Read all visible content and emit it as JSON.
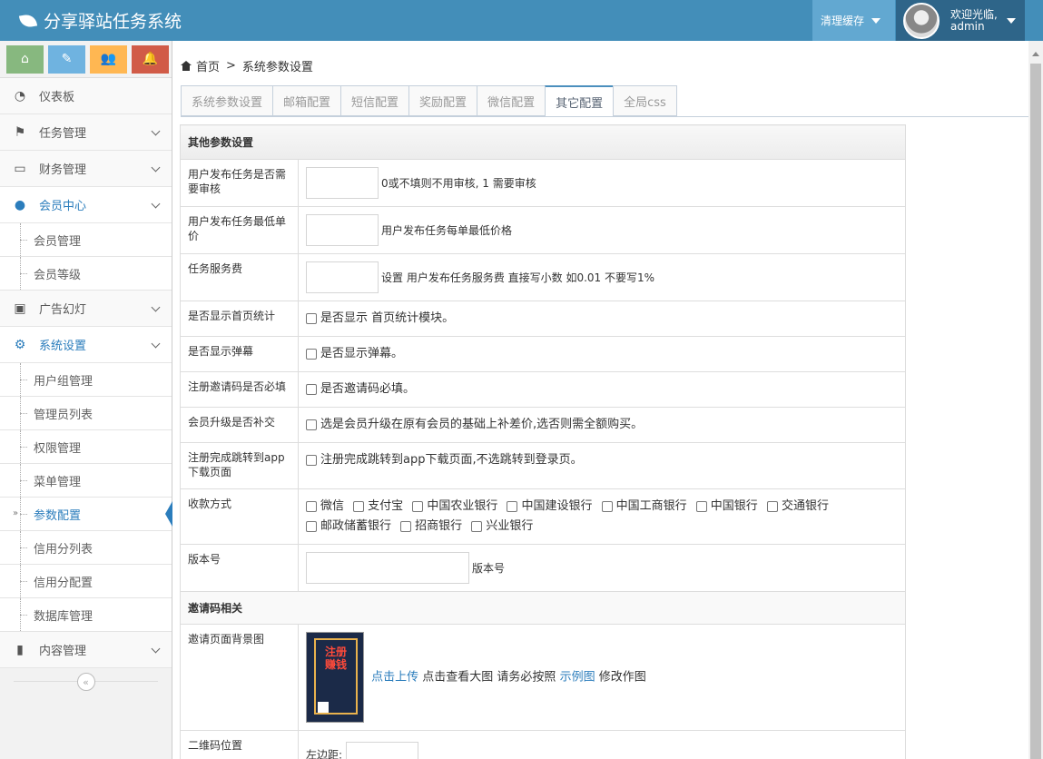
{
  "app": {
    "title": "分享驿站任务系统"
  },
  "topbar": {
    "clear_cache": "清理缓存",
    "welcome": "欢迎光临,",
    "username": "admin"
  },
  "sidebar": {
    "shortcuts": [
      "home-icon",
      "pencil-icon",
      "users-icon",
      "bell-icon"
    ],
    "items": [
      {
        "label": "仪表板",
        "icon": "dashboard-icon"
      },
      {
        "label": "任务管理",
        "icon": "flag-icon"
      },
      {
        "label": "财务管理",
        "icon": "inbox-icon"
      },
      {
        "label": "会员中心",
        "icon": "user-icon",
        "children": [
          "会员管理",
          "会员等级"
        ]
      },
      {
        "label": "广告幻灯",
        "icon": "picture-icon"
      },
      {
        "label": "系统设置",
        "icon": "cog-icon",
        "children": [
          "用户组管理",
          "管理员列表",
          "权限管理",
          "菜单管理",
          "参数配置",
          "信用分列表",
          "信用分配置",
          "数据库管理"
        ]
      },
      {
        "label": "内容管理",
        "icon": "book-icon"
      }
    ]
  },
  "breadcrumb": {
    "home": "首页",
    "current": "系统参数设置"
  },
  "tabs": [
    "系统参数设置",
    "邮箱配置",
    "短信配置",
    "奖励配置",
    "微信配置",
    "其它配置",
    "全局css"
  ],
  "form": {
    "section1": "其他参数设置",
    "rows": {
      "audit_label": "用户发布任务是否需要审核",
      "audit_hint": "0或不填则不用审核, 1 需要审核",
      "min_price_label": "用户发布任务最低单价",
      "min_price_hint": "用户发布任务每单最低价格",
      "fee_label": "任务服务费",
      "fee_hint": "设置 用户发布任务服务费 直接写小数 如0.01 不要写1%",
      "home_stats_label": "是否显示首页统计",
      "home_stats_hint": "是否显示 首页统计模块。",
      "danmu_label": "是否显示弹幕",
      "danmu_hint": "是否显示弹幕。",
      "invite_required_label": "注册邀请码是否必填",
      "invite_required_hint": "是否邀请码必填。",
      "upgrade_label": "会员升级是否补交",
      "upgrade_hint": "选是会员升级在原有会员的基础上补差价,选否则需全额购买。",
      "app_redirect_label": "注册完成跳转到app下载页面",
      "app_redirect_hint": "注册完成跳转到app下载页面,不选跳转到登录页。",
      "payment_label": "收款方式",
      "payment_options": [
        "微信",
        "支付宝",
        "中国农业银行",
        "中国建设银行",
        "中国工商银行",
        "中国银行",
        "交通银行",
        "邮政储蓄银行",
        "招商银行",
        "兴业银行"
      ],
      "version_label": "版本号",
      "version_hint": "版本号"
    },
    "section2": "邀请码相关",
    "invite": {
      "bg_label": "邀请页面背景图",
      "poster_text": "注册赚钱",
      "upload_link": "点击上传",
      "view_text": "点击查看大图 请务必按照",
      "example_link": "示例图",
      "modify_text": "修改作图",
      "qr_label": "二维码位置",
      "left_label": "左边距:"
    }
  }
}
